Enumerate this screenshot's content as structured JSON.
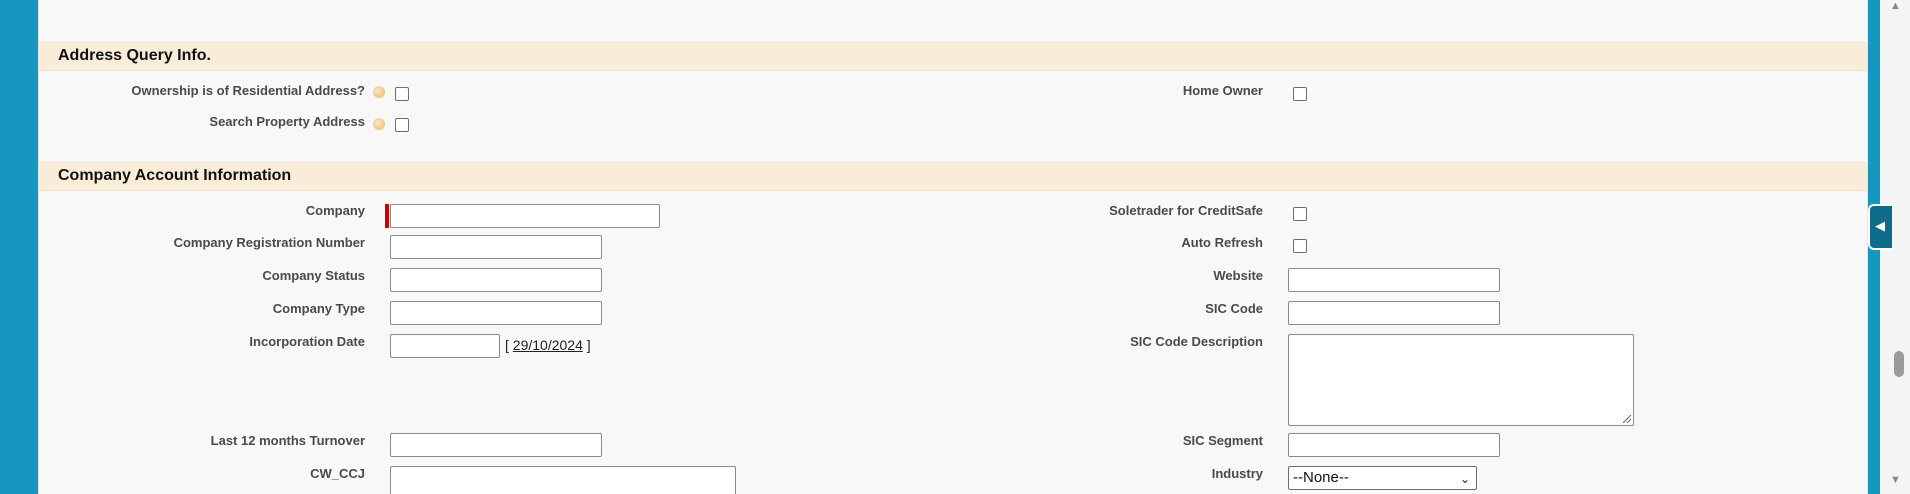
{
  "sections": {
    "address": {
      "title": "Address Query Info."
    },
    "company": {
      "title": "Company Account Information"
    }
  },
  "address": {
    "ownership_label": "Ownership is of Residential Address?",
    "search_property_label": "Search Property Address",
    "home_owner_label": "Home Owner"
  },
  "company": {
    "company_label": "Company",
    "company_value": "",
    "registration_label": "Company Registration Number",
    "status_label": "Company Status",
    "type_label": "Company Type",
    "incorporation_label": "Incorporation Date",
    "incorporation_bracket_open": "[",
    "incorporation_today": "29/10/2024",
    "incorporation_bracket_close": "]",
    "turnover_label": "Last 12 months Turnover",
    "ccj_label": "CW_CCJ",
    "soletrader_label": "Soletrader for CreditSafe",
    "auto_refresh_label": "Auto Refresh",
    "website_label": "Website",
    "sic_code_label": "SIC Code",
    "sic_desc_label": "SIC Code Description",
    "sic_segment_label": "SIC Segment",
    "industry_label": "Industry",
    "industry_selected": "--None--"
  },
  "icons": {
    "help": "help-icon",
    "collapse": "chevron-left-icon",
    "scroll_up": "scroll-up-icon",
    "scroll_down": "scroll-down-icon"
  },
  "glyphs": {
    "collapse": "◀",
    "scroll_up": "▲",
    "scroll_down": "▼",
    "select_arrow": "⌄"
  },
  "colors": {
    "page_bg": "#1797c0",
    "section_header_bg": "#f9ecd9",
    "required_bar": "#cc0000"
  }
}
